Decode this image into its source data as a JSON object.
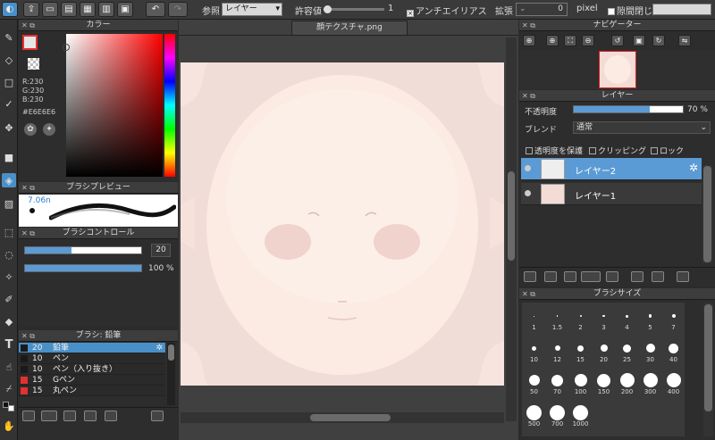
{
  "toolbar": {
    "ref_label": "参照",
    "ref_value": "レイヤー",
    "tolerance_label": "許容値",
    "tolerance_value": "1",
    "antialias_label": "アンチエイリアス",
    "expand_label": "拡張",
    "expand_value": "0",
    "expand_unit": "pixel",
    "close_gap_label": "隙間閉じ"
  },
  "color_panel": {
    "title": "カラー",
    "r": "R:230",
    "g": "G:230",
    "b": "B:230",
    "hex": "#E6E6E6"
  },
  "brush_preview": {
    "title": "ブラシプレビュー",
    "size": "7.06n"
  },
  "brush_control": {
    "title": "ブラシコントロール",
    "size_value": "20",
    "size_fraction": 0.33,
    "opacity_value": "100 %",
    "opacity_fraction": 1.0
  },
  "brush_list": {
    "title": "ブラシ: 鉛筆",
    "items": [
      {
        "size": "20",
        "name": "鉛筆",
        "color": "#1a1a1a",
        "selected": true
      },
      {
        "size": "10",
        "name": "ペン",
        "color": "#1a1a1a",
        "selected": false
      },
      {
        "size": "10",
        "name": "ペン（入り抜き）",
        "color": "#1a1a1a",
        "selected": false
      },
      {
        "size": "15",
        "name": "Gペン",
        "color": "#e53030",
        "selected": false
      },
      {
        "size": "15",
        "name": "丸ペン",
        "color": "#e53030",
        "selected": false
      }
    ]
  },
  "canvas": {
    "tab_title": "顔テクスチャ.png"
  },
  "navigator": {
    "title": "ナビゲーター"
  },
  "layer_panel": {
    "title": "レイヤー",
    "opacity_label": "不透明度",
    "opacity_value": "70 %",
    "opacity_fraction": 0.7,
    "blend_label": "ブレンド",
    "blend_value": "通常",
    "protect_alpha": "透明度を保護",
    "clipping": "クリッピング",
    "lock": "ロック",
    "layers": [
      {
        "name": "レイヤー2",
        "selected": true
      },
      {
        "name": "レイヤー1",
        "selected": false
      }
    ]
  },
  "brush_size_panel": {
    "title": "ブラシサイズ",
    "sizes": [
      "1",
      "1.5",
      "2",
      "3",
      "4",
      "5",
      "7",
      "10",
      "12",
      "15",
      "20",
      "25",
      "30",
      "40",
      "50",
      "70",
      "100",
      "150",
      "200",
      "300",
      "400",
      "500",
      "700",
      "1000"
    ]
  }
}
